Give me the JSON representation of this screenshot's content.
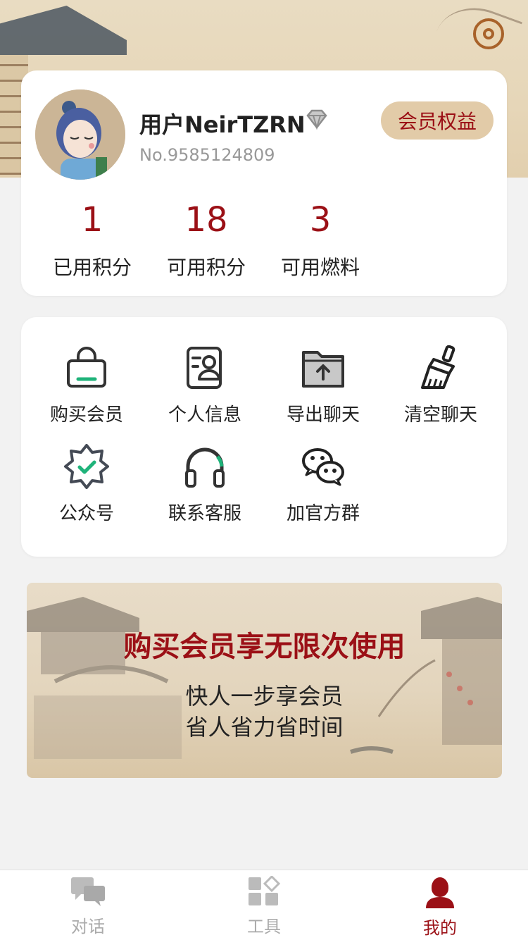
{
  "user": {
    "name": "用户NeirTZRN",
    "number": "No.9585124809",
    "vip_button": "会员权益"
  },
  "stats": [
    {
      "value": "1",
      "label": "已用积分"
    },
    {
      "value": "18",
      "label": "可用积分"
    },
    {
      "value": "3",
      "label": "可用燃料"
    }
  ],
  "menu": [
    {
      "label": "购买会员",
      "icon": "shopping-bag-icon"
    },
    {
      "label": "个人信息",
      "icon": "profile-card-icon"
    },
    {
      "label": "导出聊天",
      "icon": "folder-export-icon"
    },
    {
      "label": "清空聊天",
      "icon": "broom-icon"
    },
    {
      "label": "公众号",
      "icon": "verified-badge-icon"
    },
    {
      "label": "联系客服",
      "icon": "headset-icon"
    },
    {
      "label": "加官方群",
      "icon": "wechat-icon"
    }
  ],
  "banner": {
    "title": "购买会员享无限次使用",
    "line1": "快人一步享会员",
    "line2": "省人省力省时间"
  },
  "tabs": [
    {
      "label": "对话",
      "icon": "chat-icon",
      "active": false
    },
    {
      "label": "工具",
      "icon": "tools-icon",
      "active": false
    },
    {
      "label": "我的",
      "icon": "user-icon",
      "active": true
    }
  ],
  "colors": {
    "accent": "#9b1016",
    "vip_button_bg": "#e2cba8",
    "icon_accent_green": "#1fb37a",
    "page_bg": "#f2f2f2"
  }
}
